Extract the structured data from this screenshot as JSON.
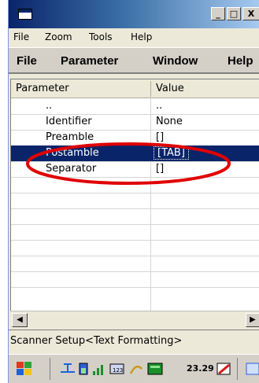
{
  "menu": [
    "File",
    "Zoom",
    "Tools",
    "Help"
  ],
  "menu_large": [
    "File",
    "Parameter",
    "Window",
    "Help"
  ],
  "columns": [
    "Parameter",
    "Value"
  ],
  "rows": [
    {
      "param": "..",
      "value": ".."
    },
    {
      "param": "Identifier",
      "value": "None"
    },
    {
      "param": "Preamble",
      "value": "[]"
    },
    {
      "param": "Postamble",
      "value": "[TAB]",
      "selected": true
    },
    {
      "param": "Separator",
      "value": "[]"
    }
  ],
  "status_text": "Scanner Setup<Text Formatting>",
  "clock": "23.29",
  "colors": {
    "selection": "#0a246a",
    "annotation": "#e00000"
  },
  "icons": [
    "app-icon",
    "minimize-icon",
    "maximize-icon",
    "close-icon",
    "scroll-left-icon",
    "scroll-right-icon",
    "start-flag-icon",
    "network-icon",
    "battery-icon",
    "signal-icon",
    "keyboard-icon",
    "stylus-icon",
    "keyboard-toggle-icon"
  ]
}
